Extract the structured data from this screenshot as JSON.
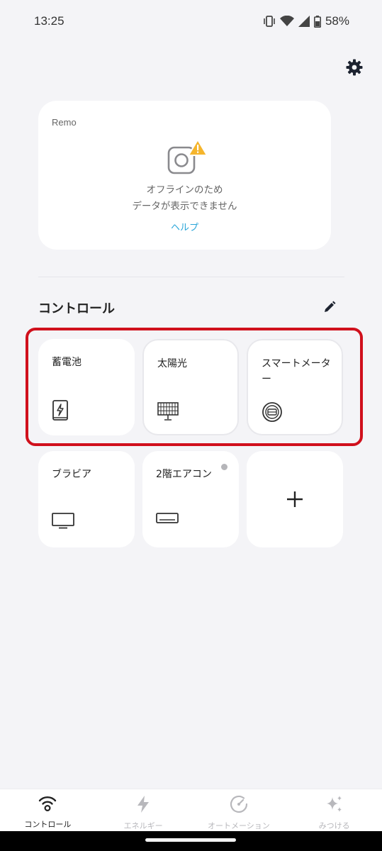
{
  "status_bar": {
    "time": "13:25",
    "battery": "58%"
  },
  "remo_card": {
    "title": "Remo",
    "message_line1": "オフラインのため",
    "message_line2": "データが表示できません",
    "help_link": "ヘルプ"
  },
  "controls": {
    "section_title": "コントロール",
    "tiles": [
      {
        "label": "蓄電池",
        "icon": "battery-storage-icon"
      },
      {
        "label": "太陽光",
        "icon": "solar-panel-icon"
      },
      {
        "label": "スマートメーター",
        "icon": "smart-meter-icon"
      },
      {
        "label": "ブラビア",
        "icon": "tv-icon"
      },
      {
        "label": "2階エアコン",
        "icon": "air-conditioner-icon"
      },
      {
        "label": "",
        "icon": "plus-icon"
      }
    ]
  },
  "bottom_nav": {
    "items": [
      {
        "label": "コントロール",
        "icon": "wifi-remote-icon",
        "active": true
      },
      {
        "label": "エネルギー",
        "icon": "lightning-icon",
        "active": false
      },
      {
        "label": "オートメーション",
        "icon": "automation-gauge-icon",
        "active": false
      },
      {
        "label": "みつける",
        "icon": "sparkle-icon",
        "active": false
      }
    ]
  },
  "colors": {
    "accent_link": "#2aa6d9",
    "highlight_border": "#d0101c",
    "warning": "#f5b52c"
  }
}
